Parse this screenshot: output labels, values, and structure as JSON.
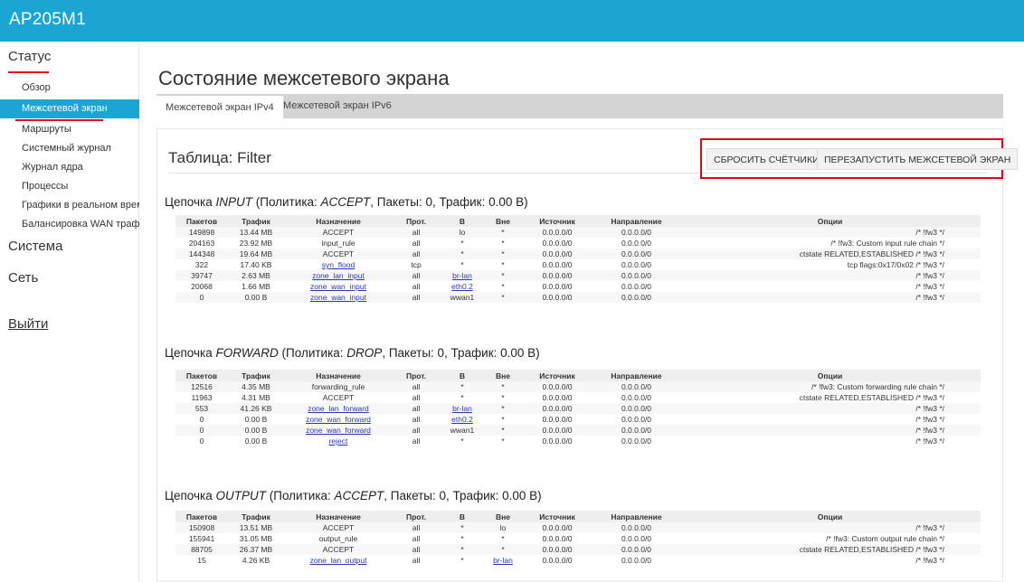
{
  "app": {
    "brand": "AP205M1"
  },
  "sidebar": {
    "status_group": "Статус",
    "items": [
      {
        "label": "Обзор"
      },
      {
        "label": "Межсетевой экран"
      },
      {
        "label": "Маршруты"
      },
      {
        "label": "Системный журнал"
      },
      {
        "label": "Журнал ядра"
      },
      {
        "label": "Процессы"
      },
      {
        "label": "Графики в реальном време"
      },
      {
        "label": "Балансировка WAN трафик"
      }
    ],
    "system_group": "Система",
    "network_group": "Сеть",
    "logout": "Выйти"
  },
  "main": {
    "title": "Состояние межсетевого экрана",
    "tabs": [
      {
        "label": "Межсетевой экран IPv4"
      },
      {
        "label": "Межсетевой экран IPv6"
      }
    ],
    "table_title": "Таблица: Filter",
    "reset_button": "СБРОСИТЬ СЧЁТЧИКИ",
    "restart_button": "ПЕРЕЗАПУСТИТЬ МЕЖСЕТЕВОЙ ЭКРАН",
    "columns": [
      "Пакетов",
      "Трафик",
      "Назначение",
      "Прот.",
      "В",
      "Вне",
      "Источник",
      "Направление",
      "Опции"
    ]
  },
  "chains": [
    {
      "prefix": "Цепочка ",
      "name": "INPUT",
      "policy_prefix": " (Политика: ",
      "policy": "ACCEPT",
      "suffix": ", Пакеты: 0, Трафик: 0.00 B)",
      "rows": [
        {
          "packets": "149898",
          "traffic": "13.44 MB",
          "target": "ACCEPT",
          "target_link": false,
          "prot": "all",
          "in": "lo",
          "in_link": false,
          "out": "*",
          "out_link": false,
          "src": "0.0.0.0/0",
          "dst": "0.0.0.0/0",
          "opts": "/* !fw3 */"
        },
        {
          "packets": "204163",
          "traffic": "23.92 MB",
          "target": "input_rule",
          "target_link": false,
          "prot": "all",
          "in": "*",
          "in_link": false,
          "out": "*",
          "out_link": false,
          "src": "0.0.0.0/0",
          "dst": "0.0.0.0/0",
          "opts": "/* !fw3: Custom input rule chain */"
        },
        {
          "packets": "144348",
          "traffic": "19.64 MB",
          "target": "ACCEPT",
          "target_link": false,
          "prot": "all",
          "in": "*",
          "in_link": false,
          "out": "*",
          "out_link": false,
          "src": "0.0.0.0/0",
          "dst": "0.0.0.0/0",
          "opts": "ctstate RELATED,ESTABLISHED /* !fw3 */"
        },
        {
          "packets": "322",
          "traffic": "17.40 KB",
          "target": "syn_flood",
          "target_link": true,
          "prot": "tcp",
          "in": "*",
          "in_link": false,
          "out": "*",
          "out_link": false,
          "src": "0.0.0.0/0",
          "dst": "0.0.0.0/0",
          "opts": "tcp flags:0x17/0x02 /* !fw3 */"
        },
        {
          "packets": "39747",
          "traffic": "2.63 MB",
          "target": "zone_lan_input",
          "target_link": true,
          "prot": "all",
          "in": "br-lan",
          "in_link": true,
          "out": "*",
          "out_link": false,
          "src": "0.0.0.0/0",
          "dst": "0.0.0.0/0",
          "opts": "/* !fw3 */"
        },
        {
          "packets": "20068",
          "traffic": "1.66 MB",
          "target": "zone_wan_input",
          "target_link": true,
          "prot": "all",
          "in": "eth0.2",
          "in_link": true,
          "out": "*",
          "out_link": false,
          "src": "0.0.0.0/0",
          "dst": "0.0.0.0/0",
          "opts": "/* !fw3 */"
        },
        {
          "packets": "0",
          "traffic": "0.00 B",
          "target": "zone_wan_input",
          "target_link": true,
          "prot": "all",
          "in": "wwan1",
          "in_link": false,
          "out": "*",
          "out_link": false,
          "src": "0.0.0.0/0",
          "dst": "0.0.0.0/0",
          "opts": "/* !fw3 */"
        }
      ]
    },
    {
      "prefix": "Цепочка ",
      "name": "FORWARD",
      "policy_prefix": " (Политика: ",
      "policy": "DROP",
      "suffix": ", Пакеты: 0, Трафик: 0.00 B)",
      "rows": [
        {
          "packets": "12516",
          "traffic": "4.35 MB",
          "target": "forwarding_rule",
          "target_link": false,
          "prot": "all",
          "in": "*",
          "in_link": false,
          "out": "*",
          "out_link": false,
          "src": "0.0.0.0/0",
          "dst": "0.0.0.0/0",
          "opts": "/* !fw3: Custom forwarding rule chain */"
        },
        {
          "packets": "11963",
          "traffic": "4.31 MB",
          "target": "ACCEPT",
          "target_link": false,
          "prot": "all",
          "in": "*",
          "in_link": false,
          "out": "*",
          "out_link": false,
          "src": "0.0.0.0/0",
          "dst": "0.0.0.0/0",
          "opts": "ctstate RELATED,ESTABLISHED /* !fw3 */"
        },
        {
          "packets": "553",
          "traffic": "41.26 KB",
          "target": "zone_lan_forward",
          "target_link": true,
          "prot": "all",
          "in": "br-lan",
          "in_link": true,
          "out": "*",
          "out_link": false,
          "src": "0.0.0.0/0",
          "dst": "0.0.0.0/0",
          "opts": "/* !fw3 */"
        },
        {
          "packets": "0",
          "traffic": "0.00 B",
          "target": "zone_wan_forward",
          "target_link": true,
          "prot": "all",
          "in": "eth0.2",
          "in_link": true,
          "out": "*",
          "out_link": false,
          "src": "0.0.0.0/0",
          "dst": "0.0.0.0/0",
          "opts": "/* !fw3 */"
        },
        {
          "packets": "0",
          "traffic": "0.00 B",
          "target": "zone_wan_forward",
          "target_link": true,
          "prot": "all",
          "in": "wwan1",
          "in_link": false,
          "out": "*",
          "out_link": false,
          "src": "0.0.0.0/0",
          "dst": "0.0.0.0/0",
          "opts": "/* !fw3 */"
        },
        {
          "packets": "0",
          "traffic": "0.00 B",
          "target": "reject",
          "target_link": true,
          "prot": "all",
          "in": "*",
          "in_link": false,
          "out": "*",
          "out_link": false,
          "src": "0.0.0.0/0",
          "dst": "0.0.0.0/0",
          "opts": "/* !fw3 */"
        }
      ]
    },
    {
      "prefix": "Цепочка ",
      "name": "OUTPUT",
      "policy_prefix": " (Политика: ",
      "policy": "ACCEPT",
      "suffix": ", Пакеты: 0, Трафик: 0.00 B)",
      "rows": [
        {
          "packets": "150908",
          "traffic": "13.51 MB",
          "target": "ACCEPT",
          "target_link": false,
          "prot": "all",
          "in": "*",
          "in_link": false,
          "out": "lo",
          "out_link": false,
          "src": "0.0.0.0/0",
          "dst": "0.0.0.0/0",
          "opts": "/* !fw3 */"
        },
        {
          "packets": "155941",
          "traffic": "31.05 MB",
          "target": "output_rule",
          "target_link": false,
          "prot": "all",
          "in": "*",
          "in_link": false,
          "out": "*",
          "out_link": false,
          "src": "0.0.0.0/0",
          "dst": "0.0.0.0/0",
          "opts": "/* !fw3: Custom output rule chain */"
        },
        {
          "packets": "88705",
          "traffic": "26.37 MB",
          "target": "ACCEPT",
          "target_link": false,
          "prot": "all",
          "in": "*",
          "in_link": false,
          "out": "*",
          "out_link": false,
          "src": "0.0.0.0/0",
          "dst": "0.0.0.0/0",
          "opts": "ctstate RELATED,ESTABLISHED /* !fw3 */"
        },
        {
          "packets": "15",
          "traffic": "4.26 KB",
          "target": "zone_lan_output",
          "target_link": true,
          "prot": "all",
          "in": "*",
          "in_link": false,
          "out": "br-lan",
          "out_link": true,
          "src": "0.0.0.0/0",
          "dst": "0.0.0.0/0",
          "opts": "/* !fw3 */"
        }
      ]
    }
  ]
}
